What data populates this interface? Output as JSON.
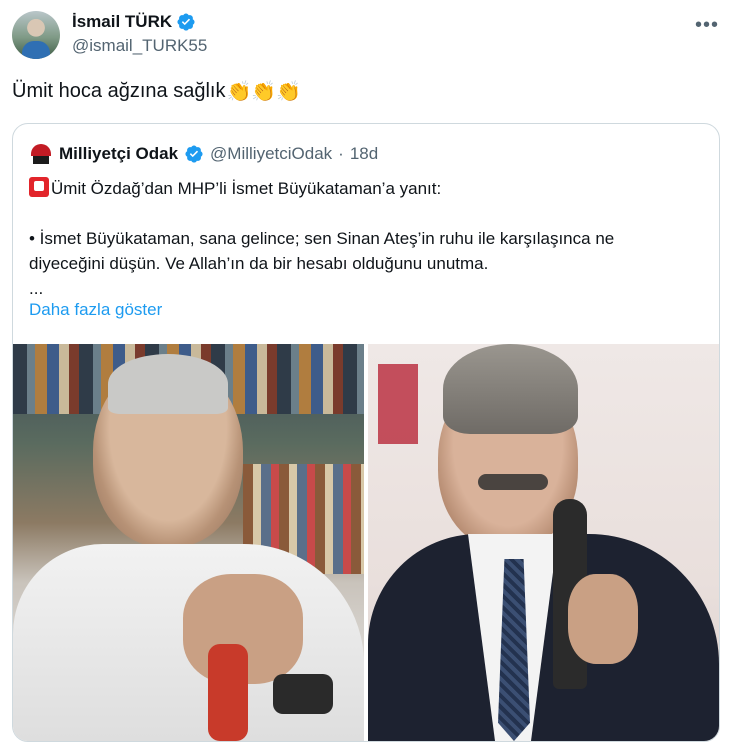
{
  "tweet": {
    "author_name": "İsmail TÜRK",
    "handle": "@ismail_TURK55",
    "more_icon": "more-horizontal-icon",
    "text": "Ümit hoca ağzına sağlık",
    "emoji": "👏👏👏"
  },
  "quote": {
    "author_name": "Milliyetçi Odak",
    "handle": "@MilliyetciOdak",
    "separator": "·",
    "time": "18d",
    "lines": [
      "Ümit Özdağ’dan MHP’li İsmet Büyükataman’a yanıt:",
      "• İsmet Büyükataman, sana gelince; sen Sinan Ateş’in ruhu ile karşılaşınca ne",
      "diyeceğini düşün. Ve Allah’ın da bir hesabı olduğunu unutma.",
      "..."
    ],
    "show_more": "Daha fazla göster"
  },
  "colors": {
    "text": "#0f1419",
    "secondary": "#536471",
    "link": "#1d9bf0",
    "verified": "#1d9bf0",
    "border": "#cfd9de",
    "siren": "#e2252b"
  }
}
